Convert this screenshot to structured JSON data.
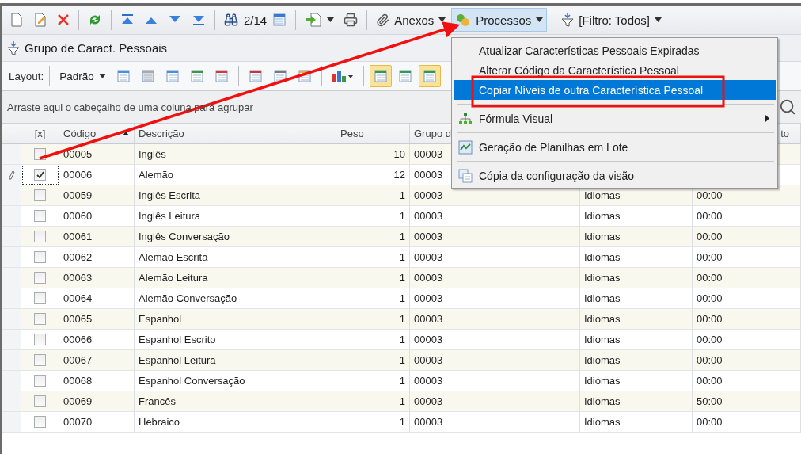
{
  "toolbar": {
    "counter": "2/14",
    "anexos": "Anexos",
    "processos": {
      "label": "Processos",
      "pressed": true
    },
    "filter": "[Filtro: Todos]"
  },
  "title": "Grupo de Caract. Pessoais",
  "layout_bar": {
    "label": "Layout:",
    "preset": "Padrão",
    "view_toggles": [
      {
        "selected": true
      },
      {
        "selected": false
      },
      {
        "selected": true
      }
    ]
  },
  "group_panel": {
    "hint": "Arraste aqui o cabeçalho de uma coluna para agrupar"
  },
  "table": {
    "columns": [
      {
        "label": "[x]"
      },
      {
        "label": "Código",
        "sorted": true
      },
      {
        "label": "Descrição"
      },
      {
        "label": "Peso"
      },
      {
        "label": "Grupo d"
      },
      {},
      {
        "label": "to"
      }
    ],
    "rows": [
      {
        "checked": false,
        "editing": false,
        "code": "00005",
        "description": "Inglês",
        "peso": "10",
        "grupo": "00003"
      },
      {
        "checked": true,
        "editing": true,
        "code": "00006",
        "description": "Alemão",
        "peso": "12",
        "grupo": "00003"
      },
      {
        "checked": false,
        "editing": false,
        "code": "00059",
        "description": "Inglês Escrita",
        "peso": "1",
        "grupo": "00003",
        "column_6": "Idiomas",
        "column_7": "00:00"
      },
      {
        "checked": false,
        "editing": false,
        "code": "00060",
        "description": "Inglês Leitura",
        "peso": "1",
        "grupo": "00003",
        "column_6": "Idiomas",
        "column_7": "00:00"
      },
      {
        "checked": false,
        "editing": false,
        "code": "00061",
        "description": "Inglês Conversação",
        "peso": "1",
        "grupo": "00003",
        "column_6": "Idiomas",
        "column_7": "00:00"
      },
      {
        "checked": false,
        "editing": false,
        "code": "00062",
        "description": "Alemão Escrita",
        "peso": "1",
        "grupo": "00003",
        "column_6": "Idiomas",
        "column_7": "00:00"
      },
      {
        "checked": false,
        "editing": false,
        "code": "00063",
        "description": "Alemão Leitura",
        "peso": "1",
        "grupo": "00003",
        "column_6": "Idiomas",
        "column_7": "00:00"
      },
      {
        "checked": false,
        "editing": false,
        "code": "00064",
        "description": "Alemão Conversação",
        "peso": "1",
        "grupo": "00003",
        "column_6": "Idiomas",
        "column_7": "00:00"
      },
      {
        "checked": false,
        "editing": false,
        "code": "00065",
        "description": "Espanhol",
        "peso": "1",
        "grupo": "00003",
        "column_6": "Idiomas",
        "column_7": "00:00"
      },
      {
        "checked": false,
        "editing": false,
        "code": "00066",
        "description": "Espanhol Escrito",
        "peso": "1",
        "grupo": "00003",
        "column_6": "Idiomas",
        "column_7": "00:00"
      },
      {
        "checked": false,
        "editing": false,
        "code": "00067",
        "description": "Espanhol Leitura",
        "peso": "1",
        "grupo": "00003",
        "column_6": "Idiomas",
        "column_7": "00:00"
      },
      {
        "checked": false,
        "editing": false,
        "code": "00068",
        "description": "Espanhol Conversação",
        "peso": "1",
        "grupo": "00003",
        "column_6": "Idiomas",
        "column_7": "00:00"
      },
      {
        "checked": false,
        "editing": false,
        "code": "00069",
        "description": "Francês",
        "peso": "1",
        "grupo": "00003",
        "column_6": "Idiomas",
        "column_7": "50:00"
      },
      {
        "checked": false,
        "editing": false,
        "code": "00070",
        "description": "Hebraico",
        "peso": "1",
        "grupo": "00003",
        "column_6": "Idiomas",
        "column_7": "00:00"
      }
    ]
  },
  "menu": {
    "items": [
      {
        "kind": "item",
        "label": "Atualizar Características Pessoais Expiradas",
        "selected": false
      },
      {
        "kind": "item",
        "label": "Alterar Código da Característica Pessoal",
        "selected": false
      },
      {
        "kind": "item",
        "label": "Copiar Níveis de outra Característica Pessoal",
        "selected": true
      },
      {
        "kind": "separator"
      },
      {
        "kind": "submenu",
        "label": "Fórmula Visual",
        "selected": false
      },
      {
        "kind": "separator"
      },
      {
        "kind": "item",
        "label": "Geração de Planilhas em Lote",
        "selected": false
      },
      {
        "kind": "separator"
      },
      {
        "kind": "item",
        "label": "Cópia da configuração da visão",
        "selected": false
      }
    ]
  }
}
